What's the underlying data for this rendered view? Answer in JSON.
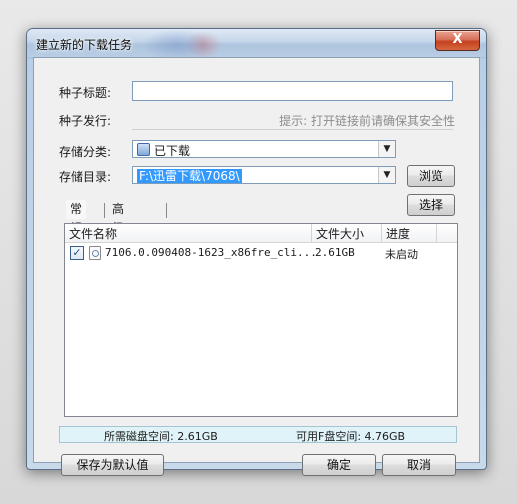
{
  "window": {
    "title": "建立新的下载任务",
    "close_label": "X"
  },
  "form": {
    "seed_title_label": "种子标题:",
    "seed_title_value": "",
    "seed_publish_label": "种子发行:",
    "hint": "提示: 打开链接前请确保其安全性",
    "category_label": "存储分类:",
    "category_value": "已下载",
    "directory_label": "存储目录:",
    "directory_value": "F:\\迅雷下载\\7068\\",
    "browse_label": "浏览",
    "select_label": "选择"
  },
  "tabs": [
    {
      "label": "常规",
      "active": true
    },
    {
      "label": "高级设置",
      "active": false
    }
  ],
  "file_list": {
    "columns": [
      "文件名称",
      "文件大小",
      "进度"
    ],
    "rows": [
      {
        "checked": true,
        "name": "7106.0.090408-1623_x86fre_cli...",
        "size": "2.61GB",
        "progress": "未启动"
      }
    ]
  },
  "status": {
    "required_space": "所需磁盘空间: 2.61GB",
    "available_space": "可用F盘空间: 4.76GB"
  },
  "buttons": {
    "save_default": "保存为默认值",
    "ok": "确定",
    "cancel": "取消"
  },
  "colors": {
    "selection": "#3399ff",
    "status_bg": "#dff3f8",
    "close_button": "#c2411f"
  }
}
